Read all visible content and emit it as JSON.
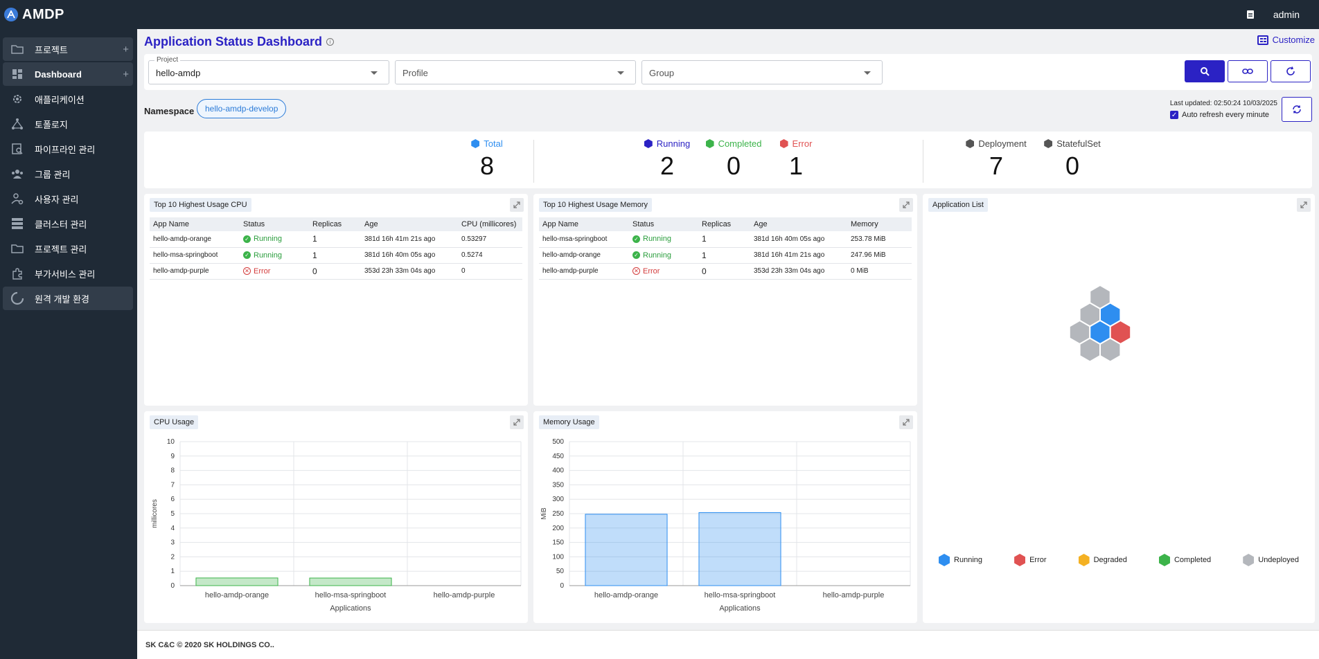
{
  "app": {
    "logo_text": "AMDP",
    "user": "admin"
  },
  "sidebar": {
    "items": [
      {
        "label": "프로젝트",
        "icon": "folder-icon",
        "plus": "+",
        "active": true
      },
      {
        "label": "Dashboard",
        "icon": "dashboard-icon",
        "plus": "+",
        "active": true
      },
      {
        "label": "애플리케이션",
        "icon": "gear-cluster-icon"
      },
      {
        "label": "토폴로지",
        "icon": "topology-icon"
      },
      {
        "label": "파이프라인 관리",
        "icon": "pipeline-icon"
      },
      {
        "label": "그룹 관리",
        "icon": "group-icon"
      },
      {
        "label": "사용자 관리",
        "icon": "user-settings-icon"
      },
      {
        "label": "클러스터 관리",
        "icon": "server-icon"
      },
      {
        "label": "프로젝트 관리",
        "icon": "folder-icon"
      },
      {
        "label": "부가서비스 관리",
        "icon": "addon-icon"
      },
      {
        "label": "원격 개발 환경",
        "icon": "loading-ring-icon",
        "active": true
      }
    ]
  },
  "header": {
    "title": "Application Status Dashboard",
    "customize": "Customize"
  },
  "filters": {
    "project": {
      "label": "Project",
      "value": "hello-amdp"
    },
    "profile": {
      "placeholder": "Profile"
    },
    "group": {
      "placeholder": "Group"
    }
  },
  "namespace": {
    "label": "Namespace",
    "value": "hello-amdp-develop"
  },
  "refresh": {
    "last_updated": "Last updated: 02:50:24 10/03/2025",
    "auto_label": "Auto refresh every minute"
  },
  "summary": {
    "total": {
      "label": "Total",
      "value": "8"
    },
    "running": {
      "label": "Running",
      "value": "2"
    },
    "completed": {
      "label": "Completed",
      "value": "0"
    },
    "error": {
      "label": "Error",
      "value": "1"
    },
    "deployment": {
      "label": "Deployment",
      "value": "7"
    },
    "statefulset": {
      "label": "StatefulSet",
      "value": "0"
    }
  },
  "cpu_table": {
    "title": "Top 10 Highest Usage CPU",
    "headers": [
      "App Name",
      "Status",
      "Replicas",
      "Age",
      "CPU (millicores)"
    ],
    "rows": [
      [
        "hello-amdp-orange",
        "Running",
        "1",
        "381d 16h 41m 21s ago",
        "0.53297"
      ],
      [
        "hello-msa-springboot",
        "Running",
        "1",
        "381d 16h 40m 05s ago",
        "0.5274"
      ],
      [
        "hello-amdp-purple",
        "Error",
        "0",
        "353d 23h 33m 04s ago",
        "0"
      ]
    ]
  },
  "mem_table": {
    "title": "Top 10 Highest Usage Memory",
    "headers": [
      "App Name",
      "Status",
      "Replicas",
      "Age",
      "Memory"
    ],
    "rows": [
      [
        "hello-msa-springboot",
        "Running",
        "1",
        "381d 16h 40m 05s ago",
        "253.78 MiB"
      ],
      [
        "hello-amdp-orange",
        "Running",
        "1",
        "381d 16h 41m 21s ago",
        "247.96 MiB"
      ],
      [
        "hello-amdp-purple",
        "Error",
        "0",
        "353d 23h 33m 04s ago",
        "0 MiB"
      ]
    ]
  },
  "app_list": {
    "title": "Application List",
    "legend": [
      {
        "label": "Running",
        "color": "#2e8ef0"
      },
      {
        "label": "Error",
        "color": "#e05252"
      },
      {
        "label": "Degraded",
        "color": "#f4b123"
      },
      {
        "label": "Completed",
        "color": "#3cb34a"
      },
      {
        "label": "Undeployed",
        "color": "#b4b7bc"
      }
    ],
    "hexes": [
      "Undeployed",
      "Undeployed",
      "Running",
      "Undeployed",
      "Running",
      "Error",
      "Undeployed",
      "Undeployed"
    ]
  },
  "cpu_chart_title": "CPU Usage",
  "mem_chart_title": "Memory Usage",
  "chart_data": [
    {
      "type": "bar",
      "title": "CPU Usage",
      "xlabel": "Applications",
      "ylabel": "millicores",
      "categories": [
        "hello-amdp-orange",
        "hello-msa-springboot",
        "hello-amdp-purple"
      ],
      "values": [
        0.53297,
        0.5274,
        0
      ],
      "ylim": [
        0,
        10
      ],
      "yticks": [
        0,
        1,
        2,
        3,
        4,
        5,
        6,
        7,
        8,
        9,
        10
      ],
      "color": "#3cb34a",
      "grid": true
    },
    {
      "type": "bar",
      "title": "Memory Usage",
      "xlabel": "Applications",
      "ylabel": "MiB",
      "categories": [
        "hello-amdp-orange",
        "hello-msa-springboot",
        "hello-amdp-purple"
      ],
      "values": [
        247.96,
        253.78,
        0
      ],
      "ylim": [
        0,
        500
      ],
      "yticks": [
        0,
        50,
        100,
        150,
        200,
        250,
        300,
        350,
        400,
        450,
        500
      ],
      "color": "#2e8ef0",
      "grid": true
    }
  ],
  "footer": {
    "text": "SK C&C © 2020 SK HOLDINGS CO.."
  }
}
